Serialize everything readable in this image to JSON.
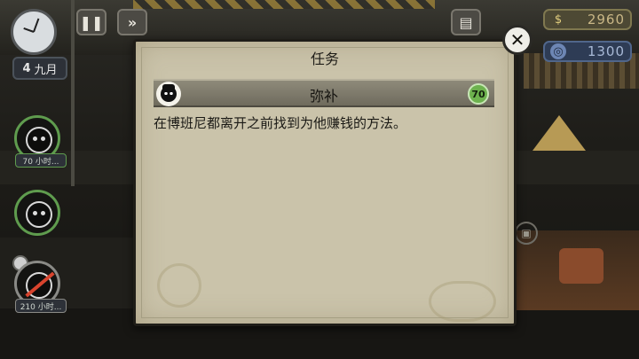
{
  "hud": {
    "date_day": "4",
    "date_month": "九月",
    "pause_glyph": "❚❚",
    "fastforward_glyph": "»",
    "money_symbol": "$",
    "money_amount": "2960",
    "coins_symbol": "◎",
    "coins_amount": "1300",
    "tv_glyph": "▣"
  },
  "characters": [
    {
      "icon": "character-portrait-1",
      "tag": "70 小时..."
    },
    {
      "icon": "character-portrait-2",
      "tag": ""
    },
    {
      "icon": "character-portrait-3",
      "tag": "210 小时..."
    }
  ],
  "dialog": {
    "title": "任务",
    "mission": {
      "name": "弥补",
      "reward": "70",
      "description": "在博班尼都离开之前找到为他赚钱的方法。"
    },
    "close_glyph": "✕"
  },
  "colors": {
    "dialog_bg": "#cac3aa",
    "reward_green": "#6db24e",
    "portrait_ring": "#5f9c4e"
  }
}
